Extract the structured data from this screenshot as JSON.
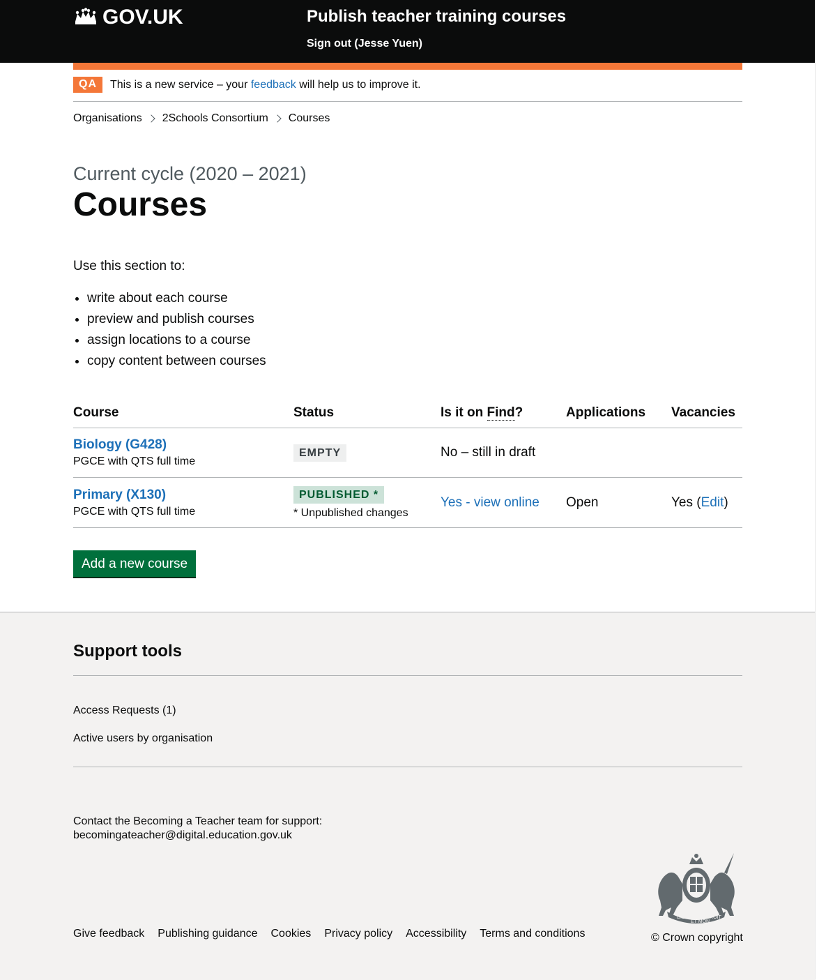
{
  "header": {
    "logo_text": "GOV.UK",
    "service_name": "Publish teacher training courses",
    "sign_out": "Sign out (Jesse Yuen)"
  },
  "phase_banner": {
    "tag": "QA",
    "text_before": "This is a new service – your ",
    "link": "feedback",
    "text_after": " will help us to improve it."
  },
  "breadcrumbs": [
    "Organisations",
    "2Schools Consortium",
    "Courses"
  ],
  "page": {
    "caption": "Current cycle (2020 – 2021)",
    "title": "Courses",
    "intro": "Use this section to:",
    "bullets": [
      "write about each course",
      "preview and publish courses",
      "assign locations to a course",
      "copy content between courses"
    ]
  },
  "table": {
    "headers": {
      "course": "Course",
      "status": "Status",
      "find_prefix": "Is it on ",
      "find_abbr": "Find",
      "find_suffix": "?",
      "applications": "Applications",
      "vacancies": "Vacancies"
    },
    "rows": [
      {
        "course": "Biology (G428)",
        "subtitle": "PGCE with QTS full time",
        "status": "EMPTY",
        "find": "No – still in draft"
      },
      {
        "course": "Primary (X130)",
        "subtitle": "PGCE with QTS full time",
        "status": "PUBLISHED *",
        "status_note": "* Unpublished changes",
        "find": "Yes - view online",
        "applications": "Open",
        "vacancies_prefix": "Yes (",
        "vacancies_link": "Edit",
        "vacancies_suffix": ")"
      }
    ]
  },
  "add_button": "Add a new course",
  "footer": {
    "support_title": "Support tools",
    "support_links": [
      "Access Requests (1)",
      "Active users by organisation"
    ],
    "contact_text": "Contact the Becoming a Teacher team for support:",
    "contact_email": "becomingateacher@digital.education.gov.uk",
    "links": [
      "Give feedback",
      "Publishing guidance",
      "Cookies",
      "Privacy policy",
      "Accessibility",
      "Terms and conditions"
    ],
    "copyright": "© Crown copyright",
    "crest_text": [
      "DIEU",
      "ET MON",
      "DROIT"
    ]
  },
  "colors": {
    "header_bg": "#0b0c0c",
    "phase_orange": "#f47738",
    "link_blue": "#1d70b8",
    "button_green": "#00703c",
    "footer_bg": "#f3f2f1"
  }
}
